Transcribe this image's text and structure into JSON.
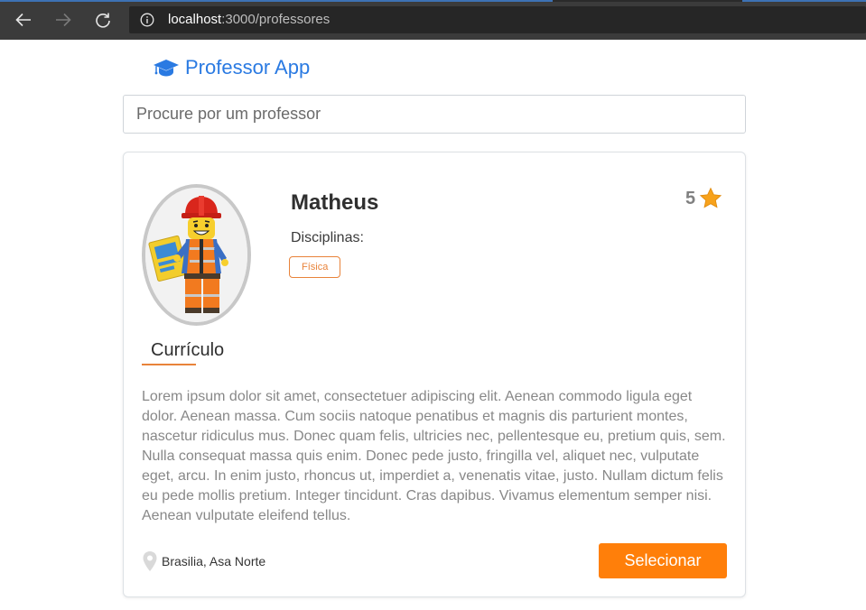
{
  "browser": {
    "url_host": "localhost",
    "url_path": ":3000/professores"
  },
  "app": {
    "brand": "Professor App",
    "brand_icon": "graduation-cap-icon",
    "accent_color": "#2a7ae2",
    "action_color": "#ff7f0a"
  },
  "search": {
    "placeholder": "Procure por um professor",
    "value": ""
  },
  "professor": {
    "name": "Matheus",
    "rating": "5",
    "rating_icon": "star-icon",
    "disciplines_label": "Disciplinas:",
    "disciplines": [
      "Física"
    ],
    "curriculum_title": "Currículo",
    "bio": "Lorem ipsum dolor sit amet, consectetuer adipiscing elit. Aenean commodo ligula eget dolor. Aenean massa. Cum sociis natoque penatibus et magnis dis parturient montes, nascetur ridiculus mus. Donec quam felis, ultricies nec, pellentesque eu, pretium quis, sem. Nulla consequat massa quis enim. Donec pede justo, fringilla vel, aliquet nec, vulputate eget, arcu. In enim justo, rhoncus ut, imperdiet a, venenatis vitae, justo. Nullam dictum felis eu pede mollis pretium. Integer tincidunt. Cras dapibus. Vivamus elementum semper nisi. Aenean vulputate eleifend tellus.",
    "location": "Brasilia, Asa Norte",
    "location_icon": "map-pin-icon",
    "select_label": "Selecionar"
  }
}
